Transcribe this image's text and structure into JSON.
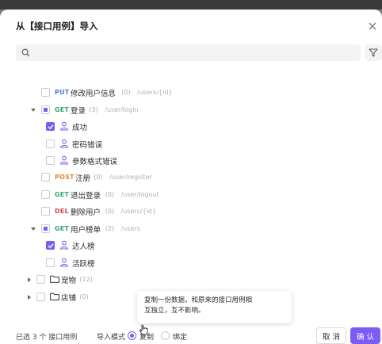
{
  "dialog": {
    "title": "从【接口用例】导入",
    "close_icon": "close-icon"
  },
  "search": {
    "placeholder": "",
    "value": "",
    "icon": "search-icon"
  },
  "filter_icon": "filter-icon",
  "tree": [
    {
      "type": "endpoint",
      "method": "PUT",
      "name": "修改用户信息",
      "count": "(0)",
      "path": "/users/{id}",
      "checked": false
    },
    {
      "type": "endpoint",
      "method": "GET",
      "name": "登录",
      "count": "(3)",
      "path": "/user/login",
      "checked": "partial",
      "expanded": true
    },
    {
      "type": "case",
      "name": "成功",
      "checked": true
    },
    {
      "type": "case",
      "name": "密码错误",
      "checked": false
    },
    {
      "type": "case",
      "name": "参数格式错误",
      "checked": false
    },
    {
      "type": "endpoint",
      "method": "POST",
      "name": "注册",
      "count": "(0)",
      "path": "/user/register",
      "checked": false
    },
    {
      "type": "endpoint",
      "method": "GET",
      "name": "退出登录",
      "count": "(0)",
      "path": "/user/logout",
      "checked": false
    },
    {
      "type": "endpoint",
      "method": "DEL",
      "name": "删除用户",
      "count": "(0)",
      "path": "/users/{id}",
      "checked": false
    },
    {
      "type": "endpoint",
      "method": "GET",
      "name": "用户榜单",
      "count": "(2)",
      "path": "/users",
      "checked": "partial",
      "expanded": true
    },
    {
      "type": "case",
      "name": "达人榜",
      "checked": true
    },
    {
      "type": "case",
      "name": "活跃榜",
      "checked": false
    },
    {
      "type": "folder",
      "name": "宠物",
      "count": "(12)",
      "checked": false
    },
    {
      "type": "folder",
      "name": "店铺",
      "count": "(0)",
      "checked": false
    }
  ],
  "tooltip": {
    "line1": "复制一份数据，和原来的接口用例相",
    "line2": "互独立，互不影响。"
  },
  "footer": {
    "selected_text": "已选 3 个 接口用例",
    "mode_label": "导入模式",
    "option_copy": "复制",
    "option_bind": "绑定",
    "selected_mode": "复制",
    "cancel_label": "取 消",
    "ok_label": "确 认"
  },
  "colors": {
    "accent": "#7c5cf5",
    "get": "#2fa86a",
    "put": "#4a7ddb",
    "post": "#e08a35",
    "del": "#d44b4b"
  }
}
